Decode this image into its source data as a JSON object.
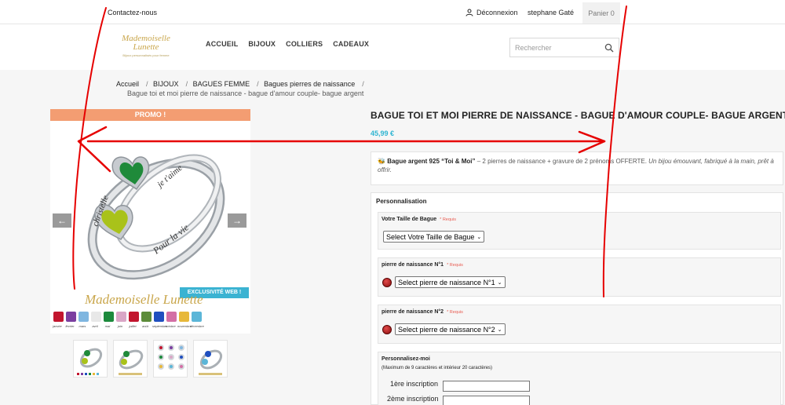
{
  "topbar": {
    "contact": "Contactez-nous",
    "logout": "Déconnexion",
    "user": "stephane Gaté",
    "cart": "Panier 0"
  },
  "header": {
    "logo_line1": "Mademoiselle",
    "logo_line2": "Lunette",
    "logo_tagline": "Bijoux personnalisés pour femme",
    "nav": [
      "ACCUEIL",
      "BIJOUX",
      "COLLIERS",
      "CADEAUX"
    ],
    "search_placeholder": "Rechercher"
  },
  "breadcrumb": {
    "items": [
      "Accueil",
      "BIJOUX",
      "BAGUES FEMME",
      "Bagues pierres de naissance"
    ],
    "current": "Bague toi et moi pierre de naissance - bague d'amour couple- bague argent"
  },
  "gallery": {
    "promo": "PROMO !",
    "exclusive": "EXCLUSIVITÉ WEB !",
    "prev_icon": "arrow-left-icon",
    "next_icon": "arrow-right-icon",
    "brand_text": "Mademoiselle Lunette",
    "ring_engravings": [
      "christelle",
      "je t'aime",
      "Pour la vie"
    ],
    "stone_colors": [
      "#c2152e",
      "#7b3fa0",
      "#7fb6e0",
      "#e8e8e8",
      "#1c8a3c",
      "#d9a6c6",
      "#c2152e",
      "#5c8c3a",
      "#1f4fbf",
      "#d36fa5",
      "#e7b83a",
      "#5bb6d8"
    ],
    "months": [
      "janvier",
      "février",
      "mars",
      "avril",
      "mai",
      "juin",
      "juillet",
      "août",
      "septembre",
      "octobre",
      "novembre",
      "décembre"
    ]
  },
  "product": {
    "title": "BAGUE TOI ET MOI PIERRE DE NAISSANCE - BAGUE D'AMOUR COUPLE- BAGUE ARGENT",
    "price": "45,99 €",
    "desc_bold": "Bague argent 925 “Toi & Moi”",
    "desc_plain": " – 2 pierres de naissance + gravure de 2 prénoms OFFERTE. ",
    "desc_italic": "Un bijou émouvant, fabriqué à la main, prêt à offrir."
  },
  "personnalisation": {
    "title": "Personnalisation",
    "size_label": "Votre Taille de Bague",
    "required": "* Requis",
    "size_select": "Select Votre Taille de Bague",
    "stone1_label": "pierre de naissance N°1",
    "stone1_select": "Select pierre de naissance N°1",
    "stone2_label": "pierre de naissance N°2",
    "stone2_select": "Select pierre de naissance N°2",
    "custom_label": "Personnalisez-moi",
    "custom_sub": "(Maximum de 9 caractères et intérieur 20 caractères)",
    "inscription1": "1ère inscription",
    "inscription2": "2ème inscription"
  },
  "colors": {
    "accent": "#2fb5d2",
    "promo": "#f39d72",
    "annotation": "#e60000"
  }
}
